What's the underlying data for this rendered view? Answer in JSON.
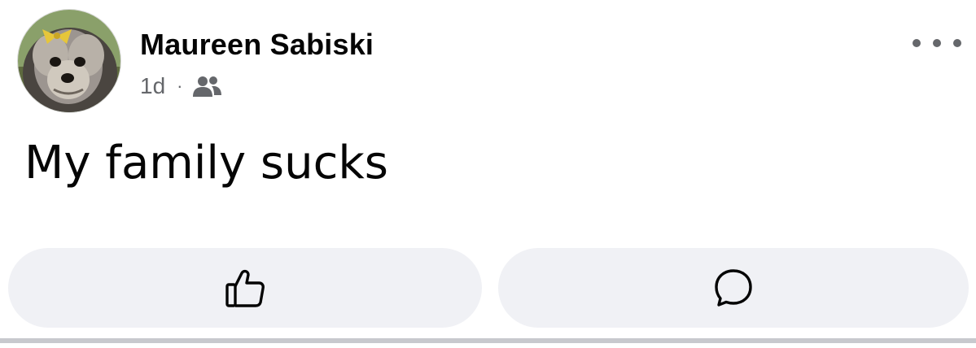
{
  "post": {
    "author_name": "Maureen Sabiski",
    "timestamp": "1d",
    "separator": "·",
    "audience_icon": "friends-icon",
    "text": "My family sucks"
  },
  "actions": {
    "like_icon": "thumbs-up-icon",
    "comment_icon": "comment-bubble-icon",
    "more_icon": "more-options-icon"
  },
  "colors": {
    "text_primary": "#050505",
    "text_secondary": "#65676b",
    "button_bg": "#f0f1f5",
    "divider": "#c8c9ce"
  }
}
